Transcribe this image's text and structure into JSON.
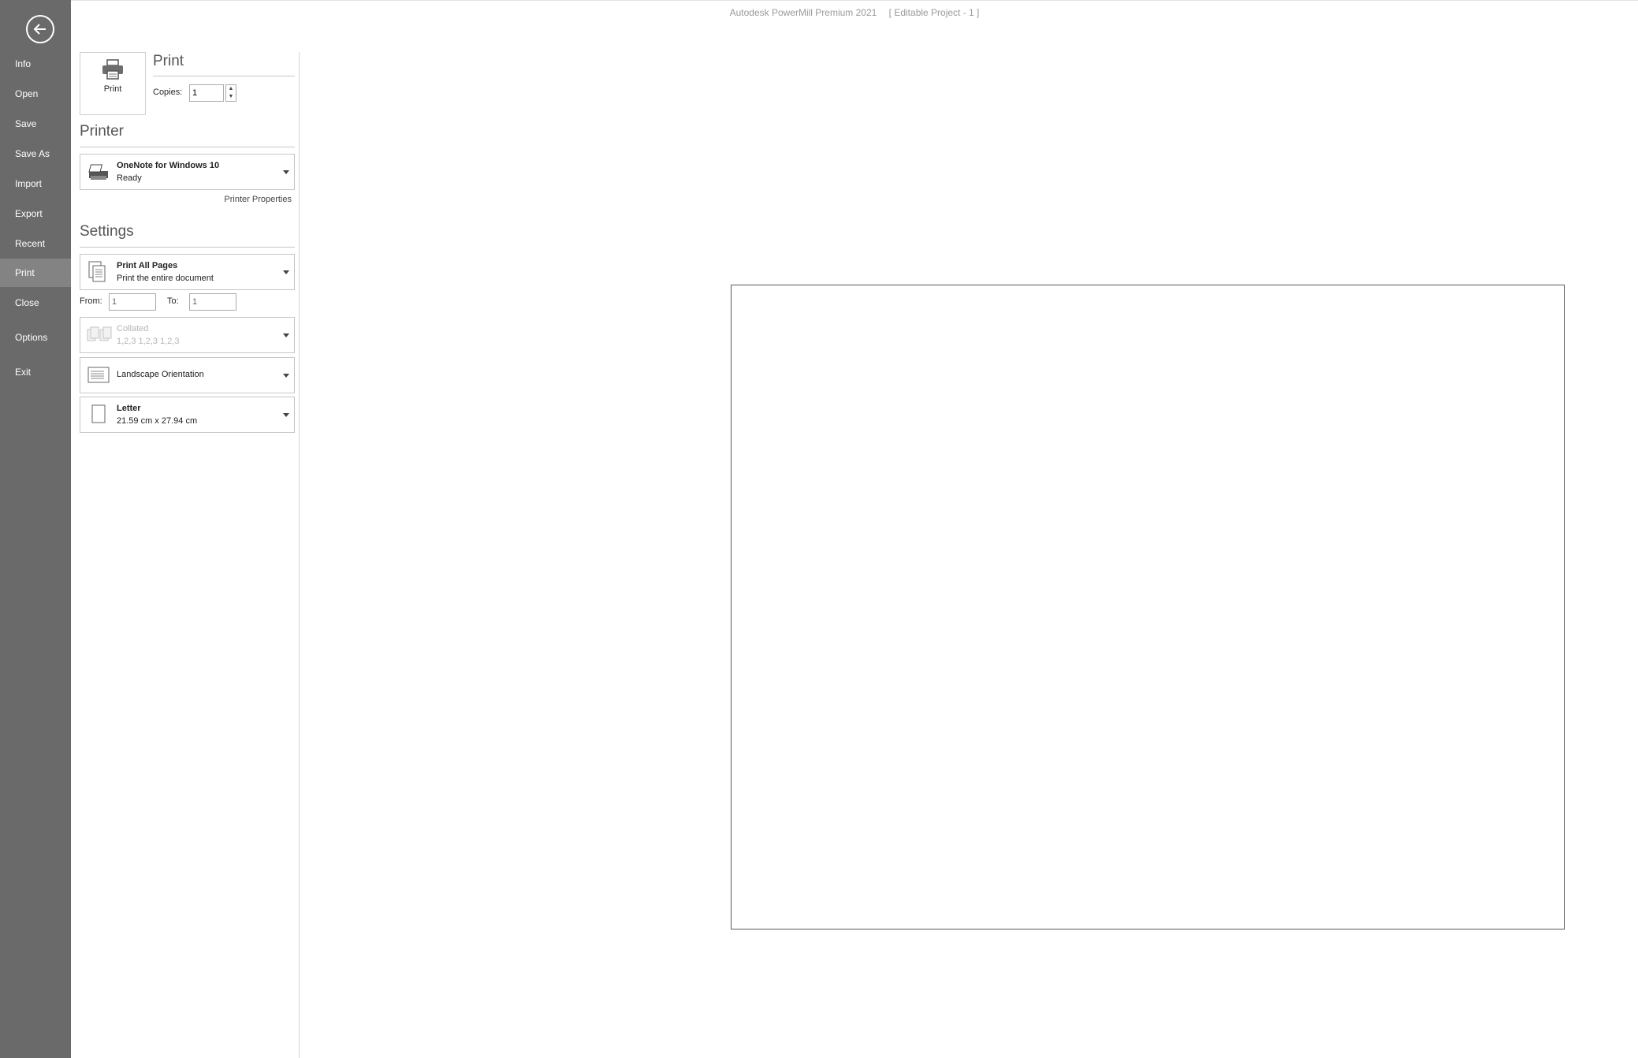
{
  "window": {
    "app_title": "Autodesk PowerMill Premium 2021",
    "project_title": "[ Editable Project - 1 ]"
  },
  "sidebar": {
    "items": [
      {
        "label": "Info"
      },
      {
        "label": "Open"
      },
      {
        "label": "Save"
      },
      {
        "label": "Save As"
      },
      {
        "label": "Import"
      },
      {
        "label": "Export"
      },
      {
        "label": "Recent"
      },
      {
        "label": "Print"
      },
      {
        "label": "Close"
      },
      {
        "label": "Options"
      },
      {
        "label": "Exit"
      }
    ],
    "active": "Print"
  },
  "print": {
    "heading": "Print",
    "button_label": "Print",
    "copies_label": "Copies:",
    "copies_value": "1"
  },
  "printer": {
    "heading": "Printer",
    "name": "OneNote for Windows 10",
    "status": "Ready",
    "properties_link": "Printer Properties"
  },
  "settings": {
    "heading": "Settings",
    "pages": {
      "title": "Print All Pages",
      "subtitle": "Print the entire document"
    },
    "from_label": "From:",
    "from_value": "1",
    "to_label": "To:",
    "to_value": "1",
    "collation": {
      "title": "Collated",
      "subtitle": "1,2,3   1,2,3   1,2,3"
    },
    "orientation": {
      "title": "Landscape Orientation"
    },
    "paper": {
      "title": "Letter",
      "subtitle": "21.59 cm x 27.94 cm"
    }
  },
  "colors": {
    "sidebar_bg": "#6a6a6a",
    "sidebar_active": "#838383"
  }
}
